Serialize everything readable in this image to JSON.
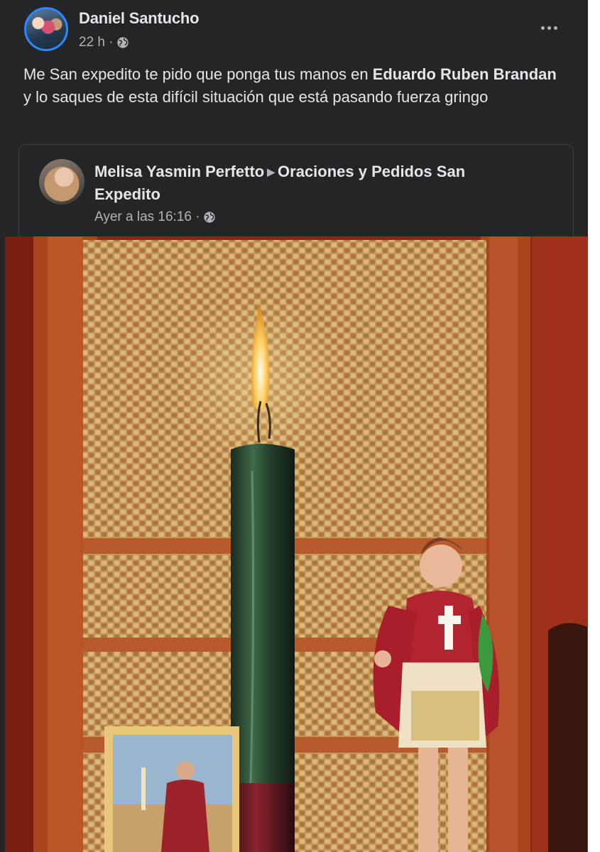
{
  "post": {
    "author": "Daniel Santucho",
    "timestamp": "22 h",
    "text_part1": "Me San expedito te pido que ponga tus manos en ",
    "tagged_name": "Eduardo Ruben Brandan",
    "text_part2": " y lo saques de esta difícil situación que está pasando fuerza gringo"
  },
  "shared_post": {
    "author": "Melisa Yasmin Perfetto",
    "group": "Oraciones y Pedidos San Expedito",
    "timestamp": "Ayer a las 16:16"
  },
  "icons": {
    "privacy": "globe-icon",
    "menu": "more-options-icon",
    "separator": "triangle-right-icon"
  },
  "colors": {
    "background": "#242526",
    "primary_text": "#e4e6eb",
    "secondary_text": "#b0b3b8",
    "avatar_ring": "#2d88ff"
  }
}
